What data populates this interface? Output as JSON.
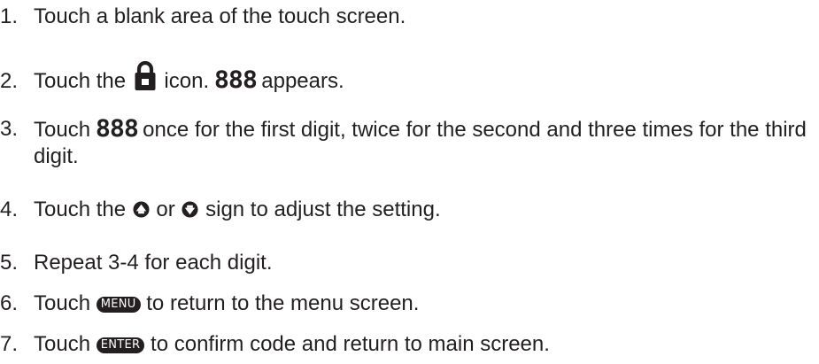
{
  "steps": [
    {
      "num": "1.",
      "text": "Touch a blank area of the touch screen."
    },
    {
      "num": "2.",
      "pre": "Touch the",
      "icon": "padlock-icon",
      "mid": "icon.",
      "code": "888",
      "post": "appears."
    },
    {
      "num": "3.",
      "pre": "Touch",
      "code": "888",
      "post": "once for the first digit, twice for the second and three times for the third digit."
    },
    {
      "num": "4.",
      "pre": "Touch the",
      "icon_up": "up-arrow-circle-icon",
      "mid": "or",
      "icon_down": "down-arrow-circle-icon",
      "post": "sign to adjust the setting."
    },
    {
      "num": "5.",
      "text": "Repeat 3-4 for each digit."
    },
    {
      "num": "6.",
      "pre": "Touch",
      "button": "MENU",
      "post": "to return to the menu screen."
    },
    {
      "num": "7.",
      "pre": "Touch",
      "button": "ENTER",
      "post": "to confirm code and return to main screen."
    }
  ]
}
